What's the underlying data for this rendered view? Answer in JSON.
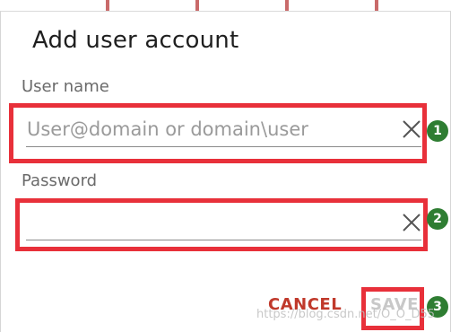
{
  "dialog": {
    "title": "Add user account",
    "username": {
      "label": "User name",
      "placeholder": "User@domain or domain\\user",
      "value": ""
    },
    "password": {
      "label": "Password",
      "value": ""
    },
    "buttons": {
      "cancel": "CANCEL",
      "save": "SAVE"
    }
  },
  "annotations": {
    "markers": [
      "1",
      "2",
      "3"
    ],
    "highlight_color": "#e8303a",
    "marker_color": "#2e7d32"
  },
  "watermark": "https://blog.csdn.net/O_O_D55"
}
